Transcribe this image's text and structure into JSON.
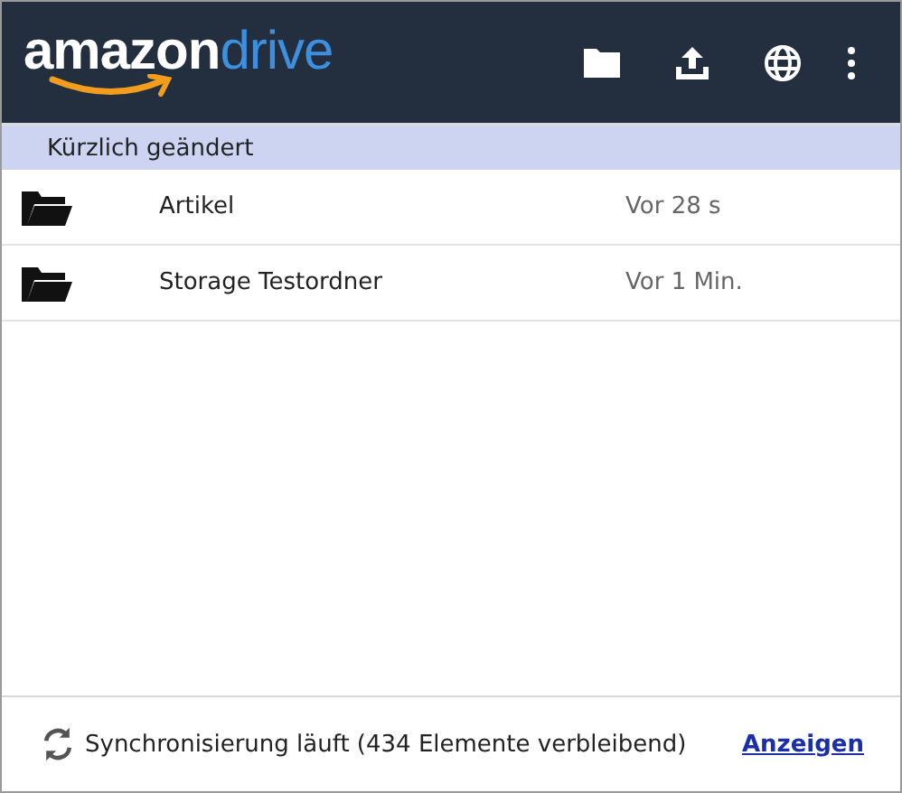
{
  "header": {
    "logo": {
      "brand": "amazon",
      "product": "drive"
    },
    "actions": [
      {
        "kind": "folder"
      },
      {
        "kind": "upload"
      },
      {
        "kind": "globe"
      },
      {
        "kind": "more"
      }
    ]
  },
  "section": {
    "title": "Kürzlich geändert"
  },
  "items": [
    {
      "name": "Artikel",
      "modified": "Vor 28 s"
    },
    {
      "name": "Storage Testordner",
      "modified": "Vor 1 Min."
    }
  ],
  "status_bar": {
    "text": "Synchronisierung läuft (434 Elemente verbleibend)",
    "link": "Anzeigen"
  }
}
